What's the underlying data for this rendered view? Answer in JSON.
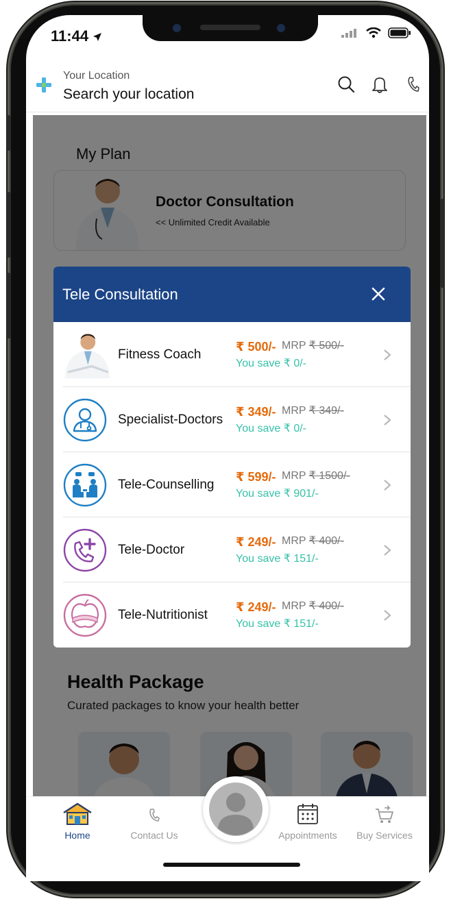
{
  "status_bar": {
    "time": "11:44"
  },
  "header": {
    "location_label": "Your Location",
    "location_value": "Search your location"
  },
  "my_plan": {
    "title": "My Plan",
    "card_title": "Doctor Consultation",
    "card_subtitle": "<< Unlimited Credit Available"
  },
  "modal": {
    "title": "Tele Consultation",
    "services": [
      {
        "name": "Fitness Coach",
        "price": "₹ 500/-",
        "mrp_label": "MRP",
        "mrp_value": "₹ 500/-",
        "save": "You save ₹ 0/-",
        "icon": "doctor-photo-icon"
      },
      {
        "name": "Specialist-Doctors",
        "price": "₹ 349/-",
        "mrp_label": "MRP",
        "mrp_value": "₹ 349/-",
        "save": "You save ₹ 0/-",
        "icon": "doctor-icon"
      },
      {
        "name": "Tele-Counselling",
        "price": "₹ 599/-",
        "mrp_label": "MRP",
        "mrp_value": "₹ 1500/-",
        "save": "You save ₹ 901/-",
        "icon": "counselling-icon"
      },
      {
        "name": "Tele-Doctor",
        "price": "₹ 249/-",
        "mrp_label": "MRP",
        "mrp_value": "₹ 400/-",
        "save": "You save ₹ 151/-",
        "icon": "phone-plus-icon"
      },
      {
        "name": "Tele-Nutritionist",
        "price": "₹ 249/-",
        "mrp_label": "MRP",
        "mrp_value": "₹ 400/-",
        "save": "You save ₹ 151/-",
        "icon": "apple-tape-icon"
      }
    ]
  },
  "health_package": {
    "title": "Health Package",
    "subtitle": "Curated packages to know your health better"
  },
  "bottom_nav": {
    "items": [
      {
        "label": "Home",
        "icon": "home-icon",
        "active": true
      },
      {
        "label": "Contact Us",
        "icon": "phone-icon",
        "active": false
      },
      {
        "label": "Appointments",
        "icon": "calendar-icon",
        "active": false
      },
      {
        "label": "Buy Services",
        "icon": "cart-icon",
        "active": false
      }
    ]
  },
  "colors": {
    "modal_header": "#1c4587",
    "price": "#e46a0c",
    "save": "#36c0a8",
    "nav_active": "#1c4587",
    "nav_inactive": "#999999"
  }
}
